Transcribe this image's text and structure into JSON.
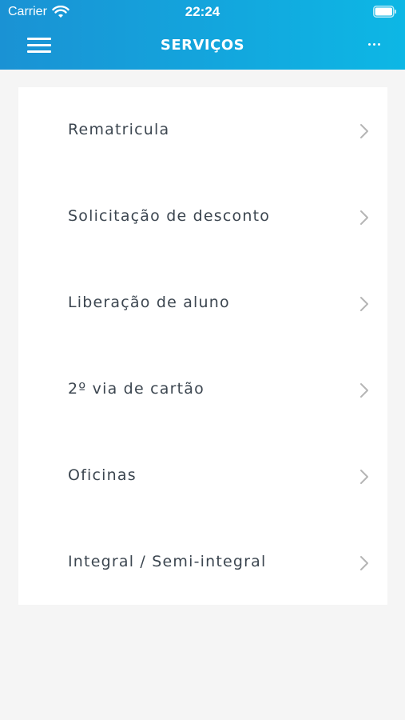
{
  "status_bar": {
    "carrier": "Carrier",
    "time": "22:24"
  },
  "nav": {
    "title": "SERVIÇOS",
    "left_icon": "hamburger-menu-icon",
    "right_icon": "more-horizontal-icon"
  },
  "colors": {
    "header_start": "#1a92d4",
    "header_end": "#0db7e5",
    "background": "#f5f5f5",
    "card": "#ffffff",
    "item_text": "#3c4650",
    "chevron": "#b5b5b5"
  },
  "services": {
    "items": [
      {
        "label": "Rematricula",
        "icon": "chevron-right-icon"
      },
      {
        "label": "Solicitação de desconto",
        "icon": "chevron-right-icon"
      },
      {
        "label": "Liberação de aluno",
        "icon": "chevron-right-icon"
      },
      {
        "label": "2º via de cartão",
        "icon": "chevron-right-icon"
      },
      {
        "label": "Oficinas",
        "icon": "chevron-right-icon"
      },
      {
        "label": "Integral / Semi-integral",
        "icon": "chevron-right-icon"
      }
    ]
  }
}
